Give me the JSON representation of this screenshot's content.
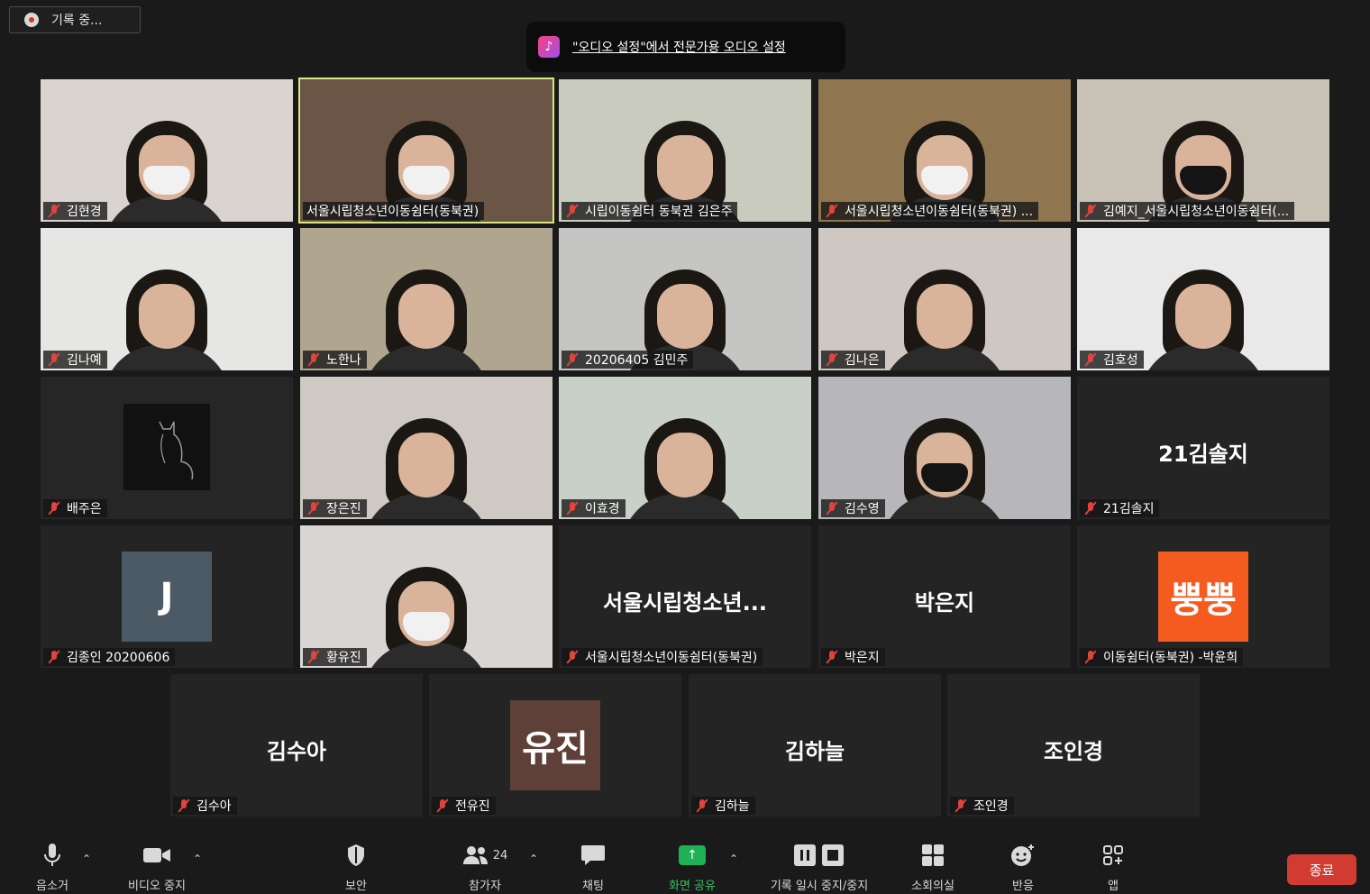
{
  "recording": {
    "label": "기록 중..."
  },
  "notification": {
    "message": "\"오디오 설정\"에서 전문가용 오디오 설정"
  },
  "tiles": [
    {
      "name": "김현경",
      "kind": "video",
      "bg": "#d9d4cf",
      "mask": "white"
    },
    {
      "name": "서울시립청소년이동쉼터(동북권)",
      "kind": "video",
      "bg": "#6b5547",
      "mask": "white",
      "active": true,
      "muted": false
    },
    {
      "name": "시립이동쉼터 동북권 김은주",
      "kind": "video",
      "bg": "#c9cbbf",
      "mask": "none"
    },
    {
      "name": "서울시립청소년이동쉼터(동북권) ...",
      "kind": "video",
      "bg": "#8f7650",
      "mask": "white"
    },
    {
      "name": "김예지_서울시립청소년이동쉼터(...",
      "kind": "video",
      "bg": "#c7c2b5",
      "mask": "black"
    },
    {
      "name": "김나예",
      "kind": "video",
      "bg": "#e6e6e4",
      "mask": "none"
    },
    {
      "name": "노한나",
      "kind": "video",
      "bg": "#b0a690",
      "mask": "none"
    },
    {
      "name": "20206405 김민주",
      "kind": "video",
      "bg": "#c5c6c3",
      "mask": "none"
    },
    {
      "name": "김나은",
      "kind": "video",
      "bg": "#cfc7c1",
      "mask": "none"
    },
    {
      "name": "김호성",
      "kind": "video",
      "bg": "#e9e9e9",
      "mask": "none"
    },
    {
      "name": "배주은",
      "kind": "video",
      "bg": "#262626",
      "mask": "none",
      "dark": true
    },
    {
      "name": "장은진",
      "kind": "video",
      "bg": "#cfc9c4",
      "mask": "none"
    },
    {
      "name": "이효경",
      "kind": "video",
      "bg": "#c9d0c7",
      "mask": "none"
    },
    {
      "name": "김수영",
      "kind": "video",
      "bg": "#b7b7bb",
      "mask": "black"
    },
    {
      "name": "21김솔지",
      "kind": "text",
      "display": "21김솔지"
    },
    {
      "name": "김종인 20200606",
      "kind": "avatar",
      "avatar": "J",
      "avatar_color": "#4b5a64"
    },
    {
      "name": "황유진",
      "kind": "video",
      "bg": "#d8d5d2",
      "mask": "white"
    },
    {
      "name": "서울시립청소년이동쉼터(동북권)",
      "kind": "text",
      "display": "서울시립청소년..."
    },
    {
      "name": "박은지",
      "kind": "text",
      "display": "박은지"
    },
    {
      "name": "이동쉼터(동북권) -박윤희",
      "kind": "avatar",
      "avatar": "뿡뿡",
      "avatar_color": "#f55a1f"
    },
    {
      "name": "김수아",
      "kind": "text",
      "display": "김수아"
    },
    {
      "name": "전유진",
      "kind": "avatar",
      "avatar": "유진",
      "avatar_color": "#5e4038"
    },
    {
      "name": "김하늘",
      "kind": "text",
      "display": "김하늘"
    },
    {
      "name": "조인경",
      "kind": "text",
      "display": "조인경"
    }
  ],
  "toolbar": {
    "mute": "음소거",
    "video": "비디오 중지",
    "security": "보안",
    "participants": "참가자",
    "participants_count": "24",
    "chat": "채팅",
    "share": "화면 공유",
    "record": "기록 일시 중지/중지",
    "breakout": "소회의실",
    "reactions": "반응",
    "apps": "앱",
    "end": "종료"
  }
}
